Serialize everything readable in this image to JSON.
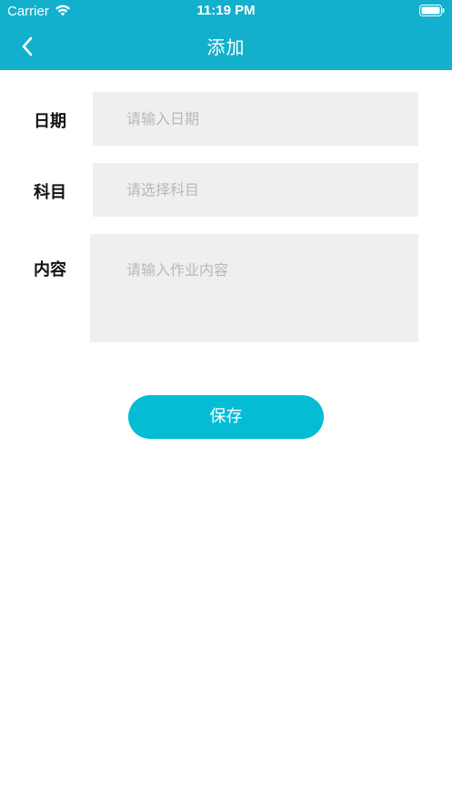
{
  "status_bar": {
    "carrier": "Carrier",
    "time": "11:19 PM",
    "wifi_icon": "wifi-icon",
    "battery_icon": "battery-icon"
  },
  "nav": {
    "back_icon": "chevron-left-icon",
    "title": "添加"
  },
  "form": {
    "date": {
      "label": "日期",
      "placeholder": "请输入日期",
      "value": ""
    },
    "subject": {
      "label": "科目",
      "placeholder": "请选择科目",
      "value": ""
    },
    "content": {
      "label": "内容",
      "placeholder": "请输入作业内容",
      "value": ""
    }
  },
  "actions": {
    "save_label": "保存"
  },
  "colors": {
    "header": "#12b0cc",
    "button": "#04bcd4",
    "field_bg": "#efefef",
    "placeholder": "#b8b8b8"
  }
}
